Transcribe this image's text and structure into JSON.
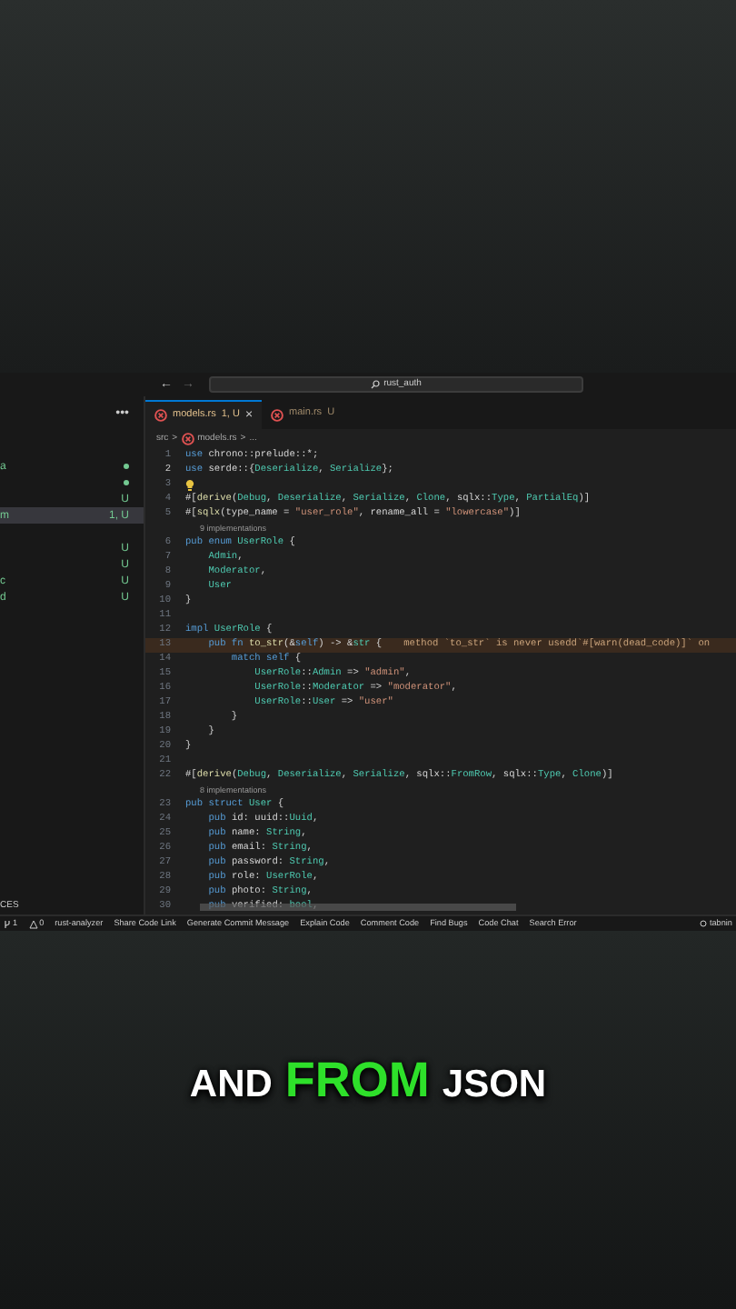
{
  "titlebar": {
    "back": "←",
    "forward": "→",
    "search": "rust_auth"
  },
  "sidebar": {
    "more": "•••",
    "items": [
      {
        "label": "a",
        "kind": "dot",
        "selected": false
      },
      {
        "kind": "dot",
        "selected": false
      },
      {
        "status": "U",
        "kind": "text",
        "selected": false
      },
      {
        "label": "m",
        "status": "1, U",
        "kind": "text",
        "selected": true
      },
      {
        "status": "U",
        "kind": "text",
        "selected": false
      },
      {
        "status": "U",
        "kind": "text",
        "selected": false
      },
      {
        "label": "c",
        "status": "U",
        "kind": "text",
        "selected": false
      },
      {
        "label": "d",
        "status": "U",
        "kind": "text",
        "selected": false
      }
    ],
    "section": "CES"
  },
  "tabs": [
    {
      "label": "models.rs",
      "badge": "1, U",
      "selected": true,
      "close": "×"
    },
    {
      "label": "main.rs",
      "badge": "U",
      "selected": false
    }
  ],
  "breadcrumb": [
    "src",
    ">",
    "models.rs",
    ">",
    "..."
  ],
  "lines": [
    {
      "kind": "code",
      "n": "1",
      "seg": [
        {
          "text": "use",
          "kind": "kw"
        },
        {
          "text": " chrono::prelude::*;",
          "kind": "p"
        }
      ]
    },
    {
      "kind": "code",
      "n": "2",
      "current": true,
      "seg": [
        {
          "text": "use",
          "kind": "kw"
        },
        {
          "text": " serde::{",
          "kind": "p"
        },
        {
          "text": "Deserialize",
          "kind": "ty"
        },
        {
          "text": ", ",
          "kind": "p"
        },
        {
          "text": "Serialize",
          "kind": "ty"
        },
        {
          "text": "};",
          "kind": "p"
        }
      ]
    },
    {
      "kind": "bulb",
      "n": "3"
    },
    {
      "kind": "code",
      "n": "4",
      "seg": [
        {
          "text": "#[",
          "kind": "p"
        },
        {
          "text": "derive",
          "kind": "fn"
        },
        {
          "text": "(",
          "kind": "p"
        },
        {
          "text": "Debug",
          "kind": "ty"
        },
        {
          "text": ", ",
          "kind": "p"
        },
        {
          "text": "Deserialize",
          "kind": "ty"
        },
        {
          "text": ", ",
          "kind": "p"
        },
        {
          "text": "Serialize",
          "kind": "ty"
        },
        {
          "text": ", ",
          "kind": "p"
        },
        {
          "text": "Clone",
          "kind": "ty"
        },
        {
          "text": ", sqlx::",
          "kind": "p"
        },
        {
          "text": "Type",
          "kind": "ty"
        },
        {
          "text": ", ",
          "kind": "p"
        },
        {
          "text": "PartialEq",
          "kind": "ty"
        },
        {
          "text": ")]",
          "kind": "p"
        }
      ]
    },
    {
      "kind": "code",
      "n": "5",
      "seg": [
        {
          "text": "#[",
          "kind": "p"
        },
        {
          "text": "sqlx",
          "kind": "fn"
        },
        {
          "text": "(type_name = ",
          "kind": "p"
        },
        {
          "text": "\"user_role\"",
          "kind": "str"
        },
        {
          "text": ", rename_all = ",
          "kind": "p"
        },
        {
          "text": "\"lowercase\"",
          "kind": "str"
        },
        {
          "text": ")]",
          "kind": "p"
        }
      ]
    },
    {
      "kind": "lens",
      "text": "9 implementations"
    },
    {
      "kind": "code",
      "n": "6",
      "seg": [
        {
          "text": "pub enum ",
          "kind": "kw"
        },
        {
          "text": "UserRole",
          "kind": "ty"
        },
        {
          "text": " {",
          "kind": "p"
        }
      ]
    },
    {
      "kind": "code",
      "n": "7",
      "seg": [
        {
          "text": "    Admin",
          "kind": "ty"
        },
        {
          "text": ",",
          "kind": "p"
        }
      ]
    },
    {
      "kind": "code",
      "n": "8",
      "seg": [
        {
          "text": "    Moderator",
          "kind": "ty"
        },
        {
          "text": ",",
          "kind": "p"
        }
      ]
    },
    {
      "kind": "code",
      "n": "9",
      "seg": [
        {
          "text": "    User",
          "kind": "ty"
        }
      ]
    },
    {
      "kind": "code",
      "n": "10",
      "seg": [
        {
          "text": "}",
          "kind": "p"
        }
      ]
    },
    {
      "kind": "code",
      "n": "11"
    },
    {
      "kind": "code",
      "n": "12",
      "seg": [
        {
          "text": "impl ",
          "kind": "kw"
        },
        {
          "text": "UserRole",
          "kind": "ty"
        },
        {
          "text": " {",
          "kind": "p"
        }
      ]
    },
    {
      "kind": "code",
      "n": "13",
      "error": true,
      "hint": "method `to_str` is never usedd`#[warn(dead_code)]` on",
      "seg": [
        {
          "text": "    pub fn ",
          "kind": "kw"
        },
        {
          "text": "to_str",
          "kind": "fn"
        },
        {
          "text": "(&",
          "kind": "p"
        },
        {
          "text": "self",
          "kind": "kw"
        },
        {
          "text": ") -> &",
          "kind": "p"
        },
        {
          "text": "str",
          "kind": "ty"
        },
        {
          "text": " {",
          "kind": "p"
        }
      ]
    },
    {
      "kind": "code",
      "n": "14",
      "seg": [
        {
          "text": "        match self",
          "kind": "kw"
        },
        {
          "text": " {",
          "kind": "p"
        }
      ]
    },
    {
      "kind": "code",
      "n": "15",
      "seg": [
        {
          "text": "            UserRole",
          "kind": "ty"
        },
        {
          "text": "::",
          "kind": "p"
        },
        {
          "text": "Admin",
          "kind": "ty"
        },
        {
          "text": " => ",
          "kind": "p"
        },
        {
          "text": "\"admin\"",
          "kind": "str"
        },
        {
          "text": ",",
          "kind": "p"
        }
      ]
    },
    {
      "kind": "code",
      "n": "16",
      "seg": [
        {
          "text": "            UserRole",
          "kind": "ty"
        },
        {
          "text": "::",
          "kind": "p"
        },
        {
          "text": "Moderator",
          "kind": "ty"
        },
        {
          "text": " => ",
          "kind": "p"
        },
        {
          "text": "\"moderator\"",
          "kind": "str"
        },
        {
          "text": ",",
          "kind": "p"
        }
      ]
    },
    {
      "kind": "code",
      "n": "17",
      "seg": [
        {
          "text": "            UserRole",
          "kind": "ty"
        },
        {
          "text": "::",
          "kind": "p"
        },
        {
          "text": "User",
          "kind": "ty"
        },
        {
          "text": " => ",
          "kind": "p"
        },
        {
          "text": "\"user\"",
          "kind": "str"
        }
      ]
    },
    {
      "kind": "code",
      "n": "18",
      "seg": [
        {
          "text": "        }",
          "kind": "p"
        }
      ]
    },
    {
      "kind": "code",
      "n": "19",
      "seg": [
        {
          "text": "    }",
          "kind": "p"
        }
      ]
    },
    {
      "kind": "code",
      "n": "20",
      "seg": [
        {
          "text": "}",
          "kind": "p"
        }
      ]
    },
    {
      "kind": "code",
      "n": "21"
    },
    {
      "kind": "code",
      "n": "22",
      "seg": [
        {
          "text": "#[",
          "kind": "p"
        },
        {
          "text": "derive",
          "kind": "fn"
        },
        {
          "text": "(",
          "kind": "p"
        },
        {
          "text": "Debug",
          "kind": "ty"
        },
        {
          "text": ", ",
          "kind": "p"
        },
        {
          "text": "Deserialize",
          "kind": "ty"
        },
        {
          "text": ", ",
          "kind": "p"
        },
        {
          "text": "Serialize",
          "kind": "ty"
        },
        {
          "text": ", sqlx::",
          "kind": "p"
        },
        {
          "text": "FromRow",
          "kind": "ty"
        },
        {
          "text": ", sqlx::",
          "kind": "p"
        },
        {
          "text": "Type",
          "kind": "ty"
        },
        {
          "text": ", ",
          "kind": "p"
        },
        {
          "text": "Clone",
          "kind": "ty"
        },
        {
          "text": ")]",
          "kind": "p"
        }
      ]
    },
    {
      "kind": "lens",
      "text": "8 implementations"
    },
    {
      "kind": "code",
      "n": "23",
      "seg": [
        {
          "text": "pub struct ",
          "kind": "kw"
        },
        {
          "text": "User",
          "kind": "ty"
        },
        {
          "text": " {",
          "kind": "p"
        }
      ]
    },
    {
      "kind": "code",
      "n": "24",
      "seg": [
        {
          "text": "    pub",
          "kind": "kw"
        },
        {
          "text": " id: uuid::",
          "kind": "p"
        },
        {
          "text": "Uuid",
          "kind": "ty"
        },
        {
          "text": ",",
          "kind": "p"
        }
      ]
    },
    {
      "kind": "code",
      "n": "25",
      "seg": [
        {
          "text": "    pub",
          "kind": "kw"
        },
        {
          "text": " name: ",
          "kind": "p"
        },
        {
          "text": "String",
          "kind": "ty"
        },
        {
          "text": ",",
          "kind": "p"
        }
      ]
    },
    {
      "kind": "code",
      "n": "26",
      "seg": [
        {
          "text": "    pub",
          "kind": "kw"
        },
        {
          "text": " email: ",
          "kind": "p"
        },
        {
          "text": "String",
          "kind": "ty"
        },
        {
          "text": ",",
          "kind": "p"
        }
      ]
    },
    {
      "kind": "code",
      "n": "27",
      "seg": [
        {
          "text": "    pub",
          "kind": "kw"
        },
        {
          "text": " password: ",
          "kind": "p"
        },
        {
          "text": "String",
          "kind": "ty"
        },
        {
          "text": ",",
          "kind": "p"
        }
      ]
    },
    {
      "kind": "code",
      "n": "28",
      "seg": [
        {
          "text": "    pub",
          "kind": "kw"
        },
        {
          "text": " role: ",
          "kind": "p"
        },
        {
          "text": "UserRole",
          "kind": "ty"
        },
        {
          "text": ",",
          "kind": "p"
        }
      ]
    },
    {
      "kind": "code",
      "n": "29",
      "seg": [
        {
          "text": "    pub",
          "kind": "kw"
        },
        {
          "text": " photo: ",
          "kind": "p"
        },
        {
          "text": "String",
          "kind": "ty"
        },
        {
          "text": ",",
          "kind": "p"
        }
      ]
    },
    {
      "kind": "code",
      "n": "30",
      "seg": [
        {
          "text": "    pub",
          "kind": "kw"
        },
        {
          "text": " verified: ",
          "kind": "p"
        },
        {
          "text": "bool",
          "kind": "ty"
        },
        {
          "text": ",",
          "kind": "p"
        }
      ]
    }
  ],
  "status_bar": {
    "items": [
      {
        "kind": "branch",
        "text": "1"
      },
      {
        "kind": "warning",
        "text": "0"
      },
      {
        "kind": "plain",
        "text": "rust-analyzer"
      },
      {
        "kind": "plain",
        "text": "Share Code Link"
      },
      {
        "kind": "plain",
        "text": "Generate Commit Message"
      },
      {
        "kind": "plain",
        "text": "Explain Code"
      },
      {
        "kind": "plain",
        "text": "Comment Code"
      },
      {
        "kind": "plain",
        "text": "Find Bugs"
      },
      {
        "kind": "plain",
        "text": "Code Chat"
      },
      {
        "kind": "plain",
        "text": "Search Error"
      }
    ],
    "right": "tabnin"
  },
  "caption": [
    {
      "text": "AND",
      "highlight": false
    },
    {
      "text": "FROM",
      "highlight": true
    },
    {
      "text": "JSON",
      "highlight": false
    }
  ]
}
